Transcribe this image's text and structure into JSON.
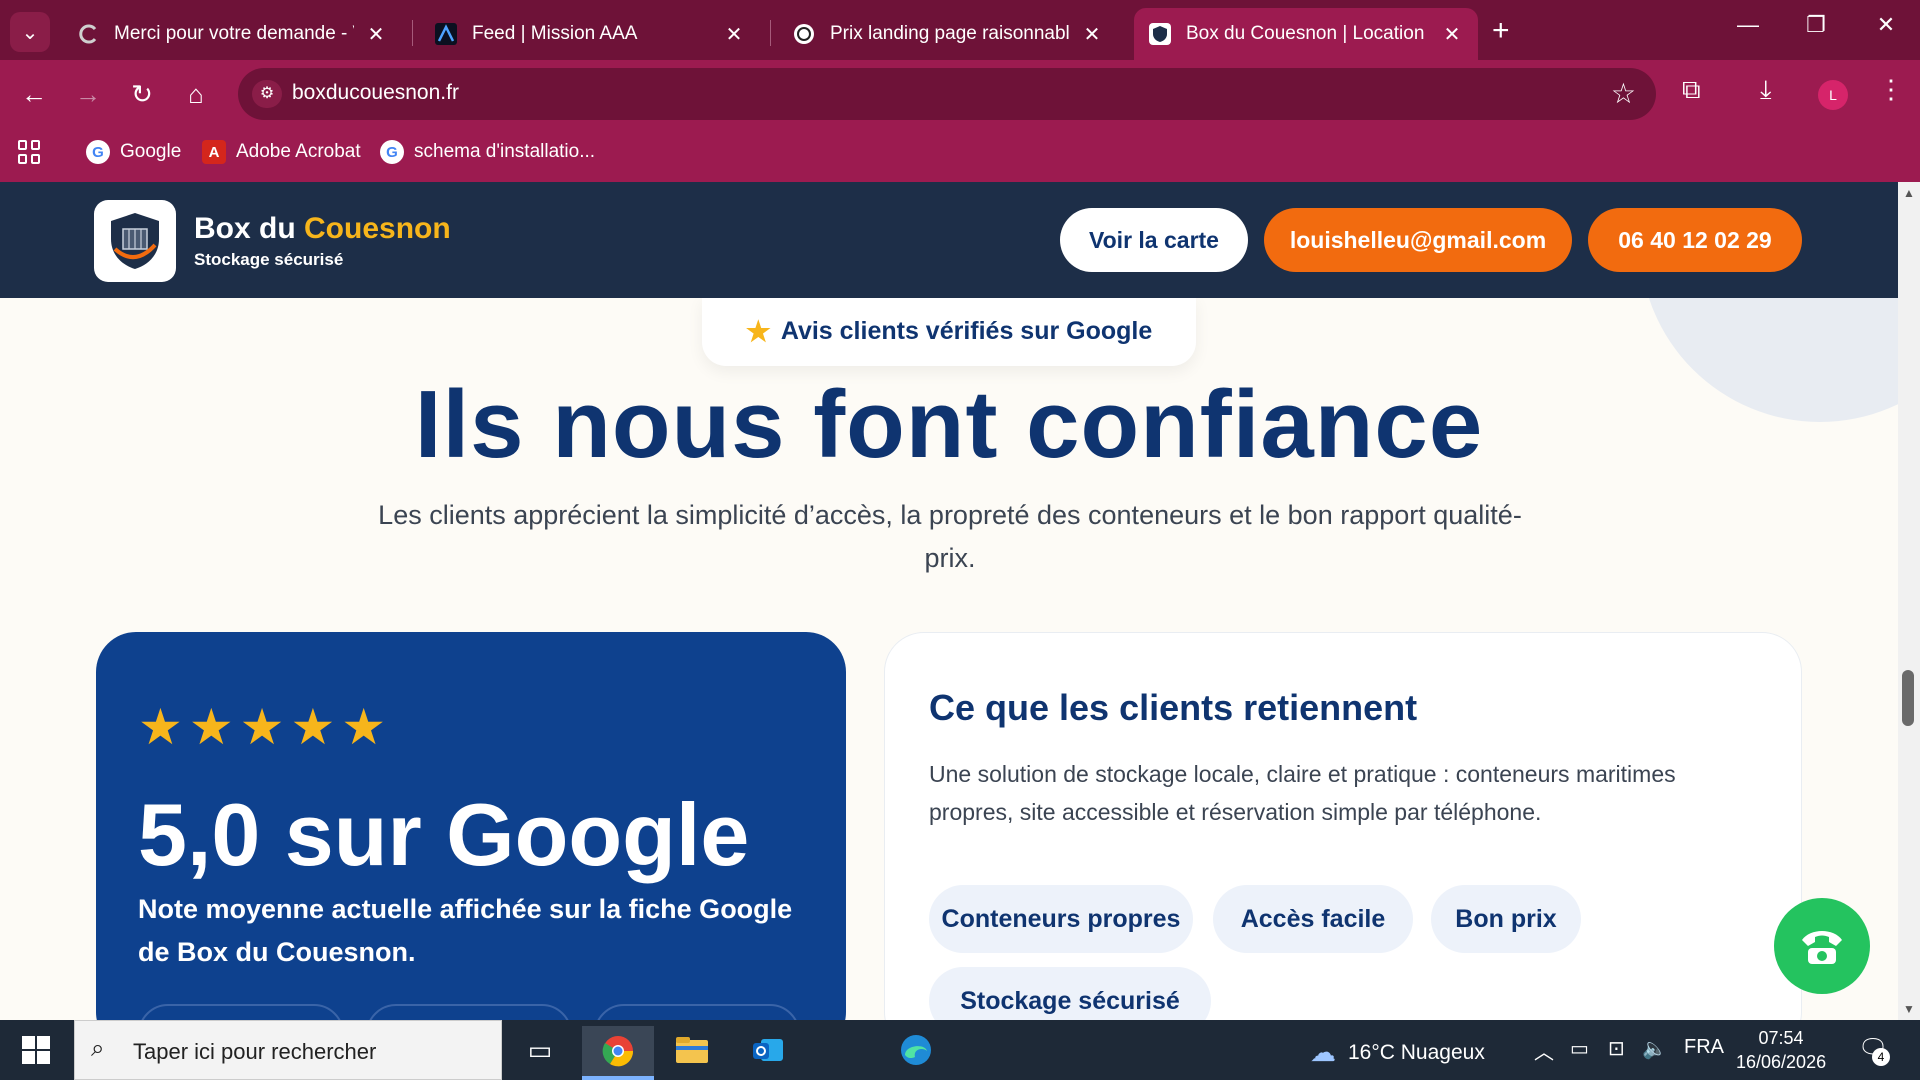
{
  "browser": {
    "tabs": [
      {
        "title": "Merci pour votre demande - Ve",
        "icon": "loading-arc-icon"
      },
      {
        "title": "Feed | Mission AAA",
        "icon": "mission-aaa-icon"
      },
      {
        "title": "Prix landing page raisonnable",
        "icon": "chatgpt-icon"
      },
      {
        "title": "Box du Couesnon | Location de",
        "icon": "shield-site-icon",
        "active": true
      }
    ],
    "url": "boxducouesnon.fr",
    "avatar_letter": "L",
    "bookmarks": [
      {
        "label": "Google",
        "icon": "google-icon"
      },
      {
        "label": "Adobe Acrobat",
        "icon": "acrobat-icon"
      },
      {
        "label": "schema d'installatio...",
        "icon": "google-icon"
      }
    ],
    "theme_color": "#9c1b50"
  },
  "site": {
    "brand_main": "Box du",
    "brand_accent": "Couesnon",
    "tagline": "Stockage sécurisé",
    "nav": {
      "map_button": "Voir la carte",
      "email_button": "louishelleu@gmail.com",
      "phone_button": "06 40 12 02 29"
    },
    "badge": "Avis clients vérifiés sur Google",
    "headline": "Ils nous font confiance",
    "subtext": "Les clients apprécient la simplicité d’accès, la propreté des conteneurs et le bon rapport qualité-prix.",
    "rating_card": {
      "stars": "★★★★★",
      "star_count": 5,
      "rating": "5,0 sur Google",
      "note": "Note moyenne actuelle affichée sur la fiche Google de Box du Couesnon."
    },
    "retain_card": {
      "title": "Ce que les clients retiennent",
      "text": "Une solution de stockage locale, claire et pratique : conteneurs maritimes propres, site accessible et réservation simple par téléphone.",
      "tags": [
        "Conteneurs propres",
        "Accès facile",
        "Bon prix",
        "Stockage sécurisé"
      ]
    },
    "colors": {
      "navy": "#0f3470",
      "orange": "#f26b0f",
      "gold": "#f7b51b",
      "header": "#1d2e48",
      "green": "#24c35f"
    }
  },
  "taskbar": {
    "search_placeholder": "Taper ici pour rechercher",
    "weather": "16°C  Nuageux",
    "language": "FRA",
    "time": "07:54",
    "date": "16/06/2026",
    "notification_count": "4"
  }
}
